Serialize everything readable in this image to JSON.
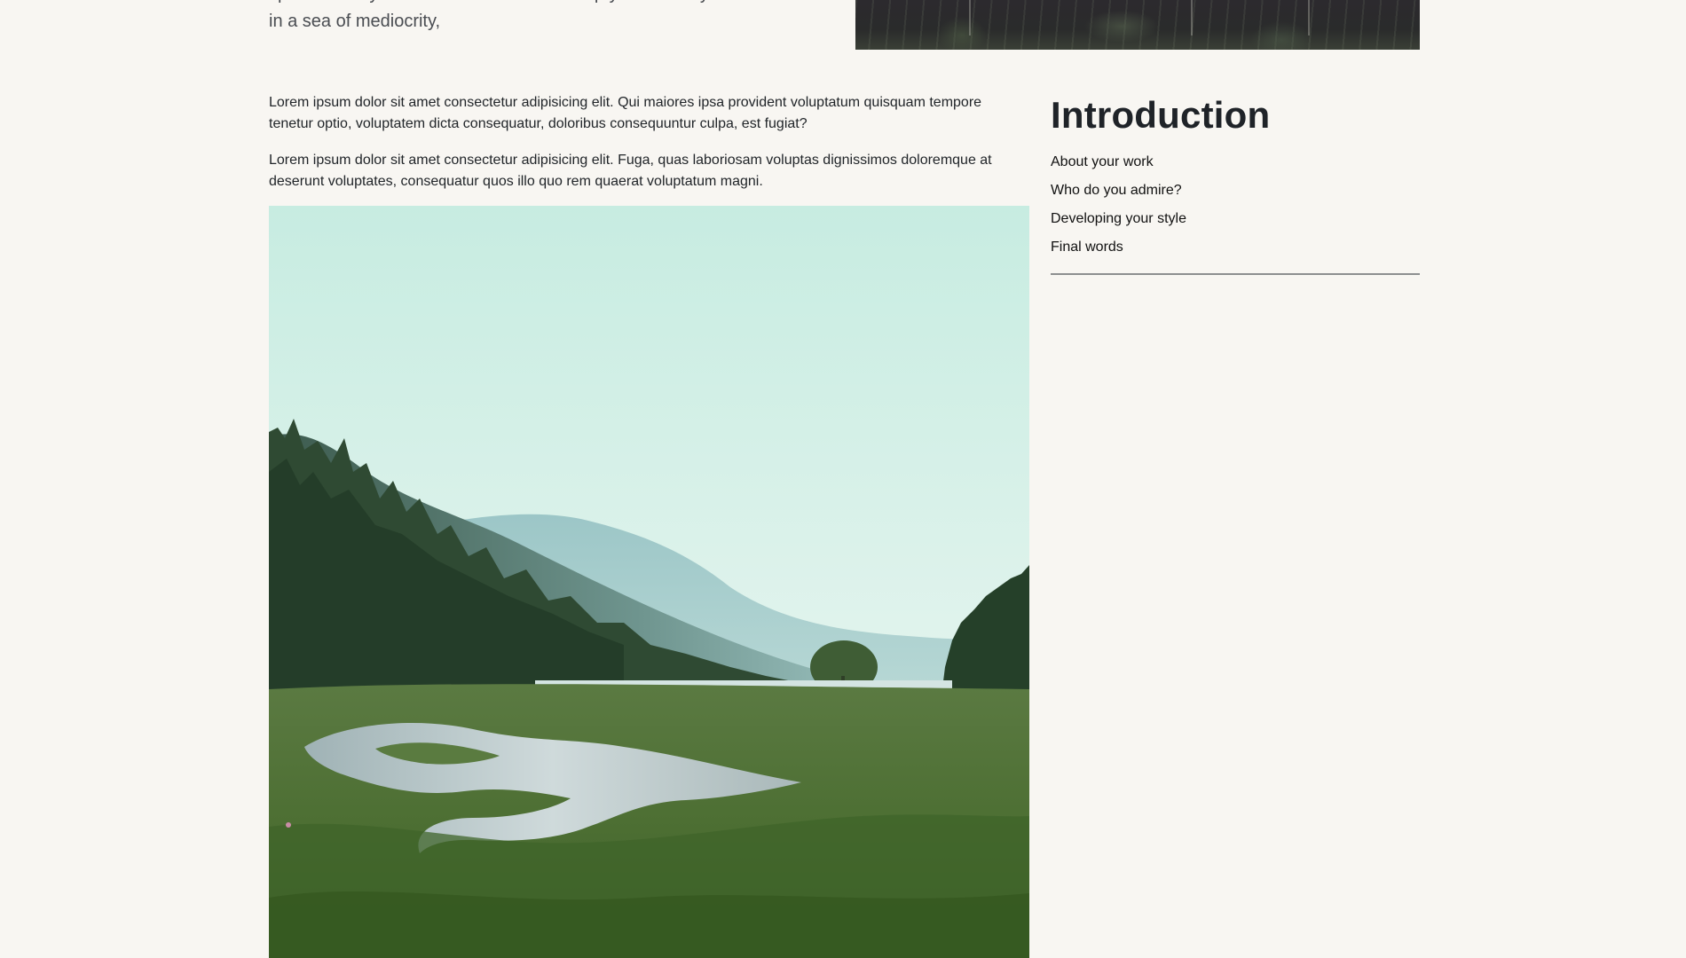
{
  "article": {
    "lede": "spoke to Lucy Midas about how to develop your own style and stand out in a sea of mediocrity,",
    "paragraphs": [
      "Lorem ipsum dolor sit amet consectetur adipisicing elit. Qui maiores ipsa provident voluptatum quisquam tempore tenetur optio, voluptatem dicta consequatur, doloribus consequuntur culpa, est fugiat?",
      "Lorem ipsum dolor sit amet consectetur adipisicing elit. Fuga, quas laboriosam voluptas dignissimos doloremque at deserunt voluptates, consequatur quos illo quo rem quaerat voluptatum magni."
    ]
  },
  "sidebar": {
    "title": "Introduction",
    "items": [
      {
        "label": "About your work"
      },
      {
        "label": "Who do you admire?"
      },
      {
        "label": "Developing your style"
      },
      {
        "label": "Final words"
      }
    ]
  },
  "colors": {
    "background": "#f8f6f2",
    "text": "#212529",
    "divider": "#8d8f90"
  }
}
